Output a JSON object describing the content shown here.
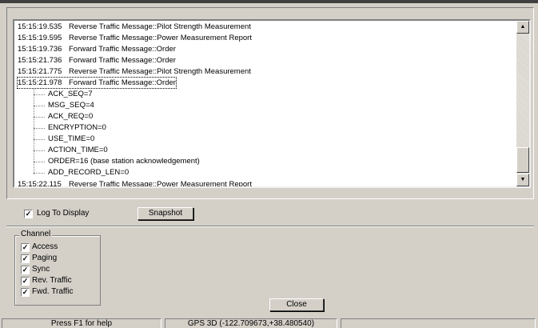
{
  "log": {
    "messages": [
      {
        "time": "15:15:19.535",
        "text": "Reverse Traffic Message::Pilot Strength Measurement"
      },
      {
        "time": "15:15:19.595",
        "text": "Reverse Traffic Message::Power Measurement Report"
      },
      {
        "time": "15:15:19.736",
        "text": "Forward Traffic Message::Order"
      },
      {
        "time": "15:15:21.736",
        "text": "Forward Traffic Message::Order"
      },
      {
        "time": "15:15:21.775",
        "text": "Reverse Traffic Message::Pilot Strength Measurement"
      },
      {
        "time": "15:15:21.978",
        "text": "Forward Traffic Message::Order"
      }
    ],
    "selected_index": 5,
    "fields": [
      "ACK_SEQ=7",
      "MSG_SEQ=4",
      "ACK_REQ=0",
      "ENCRYPTION=0",
      "USE_TIME=0",
      "ACTION_TIME=0",
      "ORDER=16 (base station acknowledgement)",
      "ADD_RECORD_LEN=0"
    ],
    "next_message": {
      "time": "15:15:22.115",
      "text": "Reverse Traffic Message::Power Measurement Report"
    }
  },
  "controls": {
    "log_to_display_label": "Log To Display",
    "log_to_display_checked": true,
    "snapshot_label": "Snapshot",
    "close_label": "Close"
  },
  "channel": {
    "title": "Channel",
    "items": [
      {
        "label": "Access",
        "checked": true
      },
      {
        "label": "Paging",
        "checked": true
      },
      {
        "label": "Sync",
        "checked": true
      },
      {
        "label": "Rev. Traffic",
        "checked": true
      },
      {
        "label": "Fwd. Traffic",
        "checked": true
      }
    ]
  },
  "statusbar": {
    "help": "Press F1 for help",
    "gps": "GPS 3D (-122.709673,+38.480540)",
    "extra": ""
  },
  "icons": {
    "scroll_up": "up-arrow-icon",
    "scroll_down": "down-arrow-icon",
    "check": "checkmark-icon"
  }
}
